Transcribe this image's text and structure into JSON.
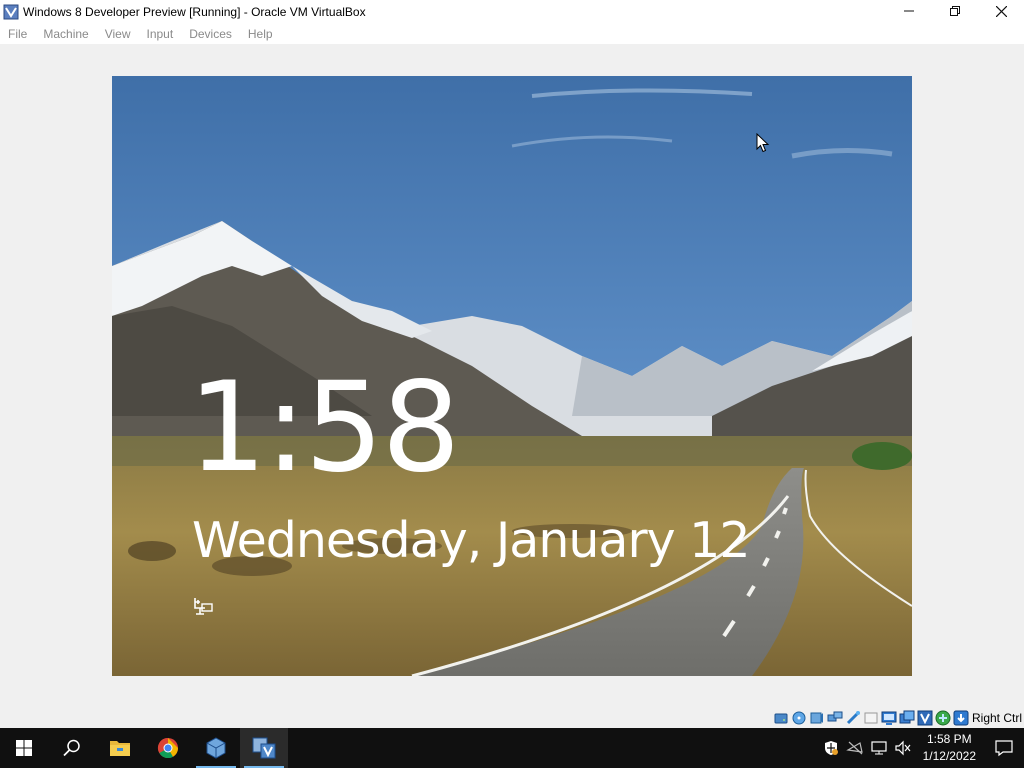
{
  "window": {
    "title": "Windows 8 Developer Preview [Running] - Oracle VM VirtualBox",
    "icon": "virtualbox-icon",
    "controls": {
      "minimize": "minimize-icon",
      "maximize": "maximize-icon",
      "close": "close-icon"
    }
  },
  "menu": {
    "items": [
      "File",
      "Machine",
      "View",
      "Input",
      "Devices",
      "Help"
    ]
  },
  "lockscreen": {
    "time": "1:58",
    "date": "Wednesday, January 12",
    "network_icon": "network-icon",
    "colors": {
      "sky": "#4e7fb8",
      "text": "#ffffff"
    }
  },
  "statusbar": {
    "icons": [
      "hard-disk-icon",
      "optical-drive-icon",
      "audio-icon",
      "network-adapter-icon",
      "usb-icon",
      "shared-folder-icon",
      "display-icon",
      "video-capture-icon",
      "cpu-icon",
      "mouse-integration-icon",
      "keyboard-icon"
    ],
    "host_key": "Right Ctrl"
  },
  "taskbar": {
    "apps": [
      "start-icon",
      "search-icon",
      "file-explorer-icon",
      "chrome-icon",
      "virtualbox-manager-icon",
      "virtualbox-vm-icon"
    ],
    "tray": {
      "icons": [
        "security-shield-icon",
        "wifi-off-icon",
        "network-icon",
        "volume-muted-icon"
      ],
      "time": "1:58 PM",
      "date": "1/12/2022"
    },
    "colors": {
      "background": "#101010",
      "accent": "#76b9ed"
    }
  }
}
